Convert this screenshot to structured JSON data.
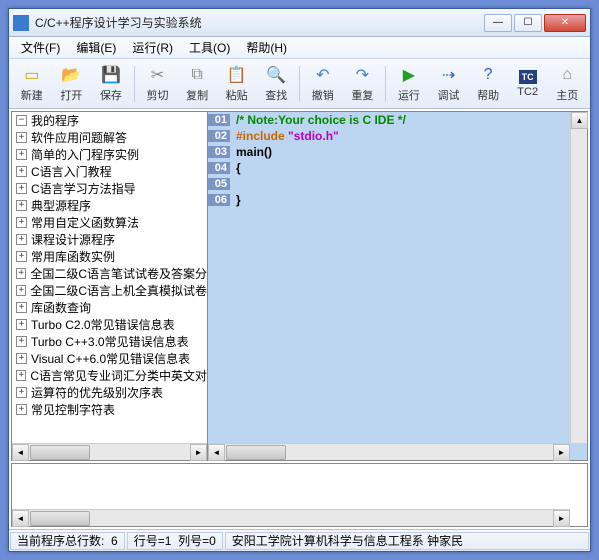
{
  "title": "C/C++程序设计学习与实验系统",
  "menu": [
    "文件(F)",
    "编辑(E)",
    "运行(R)",
    "工具(O)",
    "帮助(H)"
  ],
  "toolbar": [
    {
      "name": "new-button",
      "icon": "file-ico",
      "glyph": "▭",
      "label": "新建"
    },
    {
      "name": "open-button",
      "icon": "open-ico",
      "glyph": "📂",
      "label": "打开"
    },
    {
      "name": "save-button",
      "icon": "save-ico",
      "glyph": "💾",
      "label": "保存"
    },
    {
      "sep": true
    },
    {
      "name": "cut-button",
      "icon": "cut-ico",
      "glyph": "✂",
      "label": "剪切"
    },
    {
      "name": "copy-button",
      "icon": "copy-ico",
      "glyph": "⧉",
      "label": "复制"
    },
    {
      "name": "paste-button",
      "icon": "paste-ico",
      "glyph": "📋",
      "label": "粘贴"
    },
    {
      "name": "find-button",
      "icon": "find-ico",
      "glyph": "🔍",
      "label": "查找"
    },
    {
      "sep": true
    },
    {
      "name": "undo-button",
      "icon": "undo-ico",
      "glyph": "↶",
      "label": "撤销"
    },
    {
      "name": "redo-button",
      "icon": "redo-ico",
      "glyph": "↷",
      "label": "重复"
    },
    {
      "sep": true
    },
    {
      "name": "run-button",
      "icon": "run-ico",
      "glyph": "▶",
      "label": "运行"
    },
    {
      "name": "debug-button",
      "icon": "debug-ico",
      "glyph": "⇢",
      "label": "调试"
    },
    {
      "name": "help-button",
      "icon": "help-ico",
      "glyph": "?",
      "label": "帮助"
    },
    {
      "name": "tc2-button",
      "icon": "tc2-ico",
      "glyph": "TC",
      "label": "TC2"
    },
    {
      "name": "home-button",
      "icon": "home-ico",
      "glyph": "⌂",
      "label": "主页"
    }
  ],
  "tree_root": "我的程序",
  "tree": [
    "软件应用问题解答",
    "简单的入门程序实例",
    "C语言入门教程",
    "C语言学习方法指导",
    "典型源程序",
    "常用自定义函数算法",
    "课程设计源程序",
    "常用库函数实例",
    "全国二级C语言笔试试卷及答案分",
    "全国二级C语言上机全真模拟试卷",
    "库函数查询",
    "Turbo C2.0常见错误信息表",
    "Turbo C++3.0常见错误信息表",
    "Visual C++6.0常见错误信息表",
    "C语言常见专业词汇分类中英文对",
    "运算符的优先级别次序表",
    "常见控制字符表"
  ],
  "code": [
    {
      "n": "01",
      "cls": "c-comment",
      "t": "/* Note:Your choice is C IDE */"
    },
    {
      "n": "02",
      "cls": "c-preproc",
      "t": "#include ",
      "t2": "\"stdio.h\"",
      "cls2": "c-string"
    },
    {
      "n": "03",
      "cls": "c-text",
      "t": "main()"
    },
    {
      "n": "04",
      "cls": "c-text",
      "t": "{"
    },
    {
      "n": "05",
      "cls": "c-text",
      "t": ""
    },
    {
      "n": "06",
      "cls": "c-text",
      "t": "}"
    }
  ],
  "status": {
    "lines_label": "当前程序总行数:",
    "lines": "6",
    "row_label": "行号=",
    "row": "1",
    "col_label": "列号=",
    "col": "0",
    "credit": "安阳工学院计算机科学与信息工程系  钟家民"
  }
}
